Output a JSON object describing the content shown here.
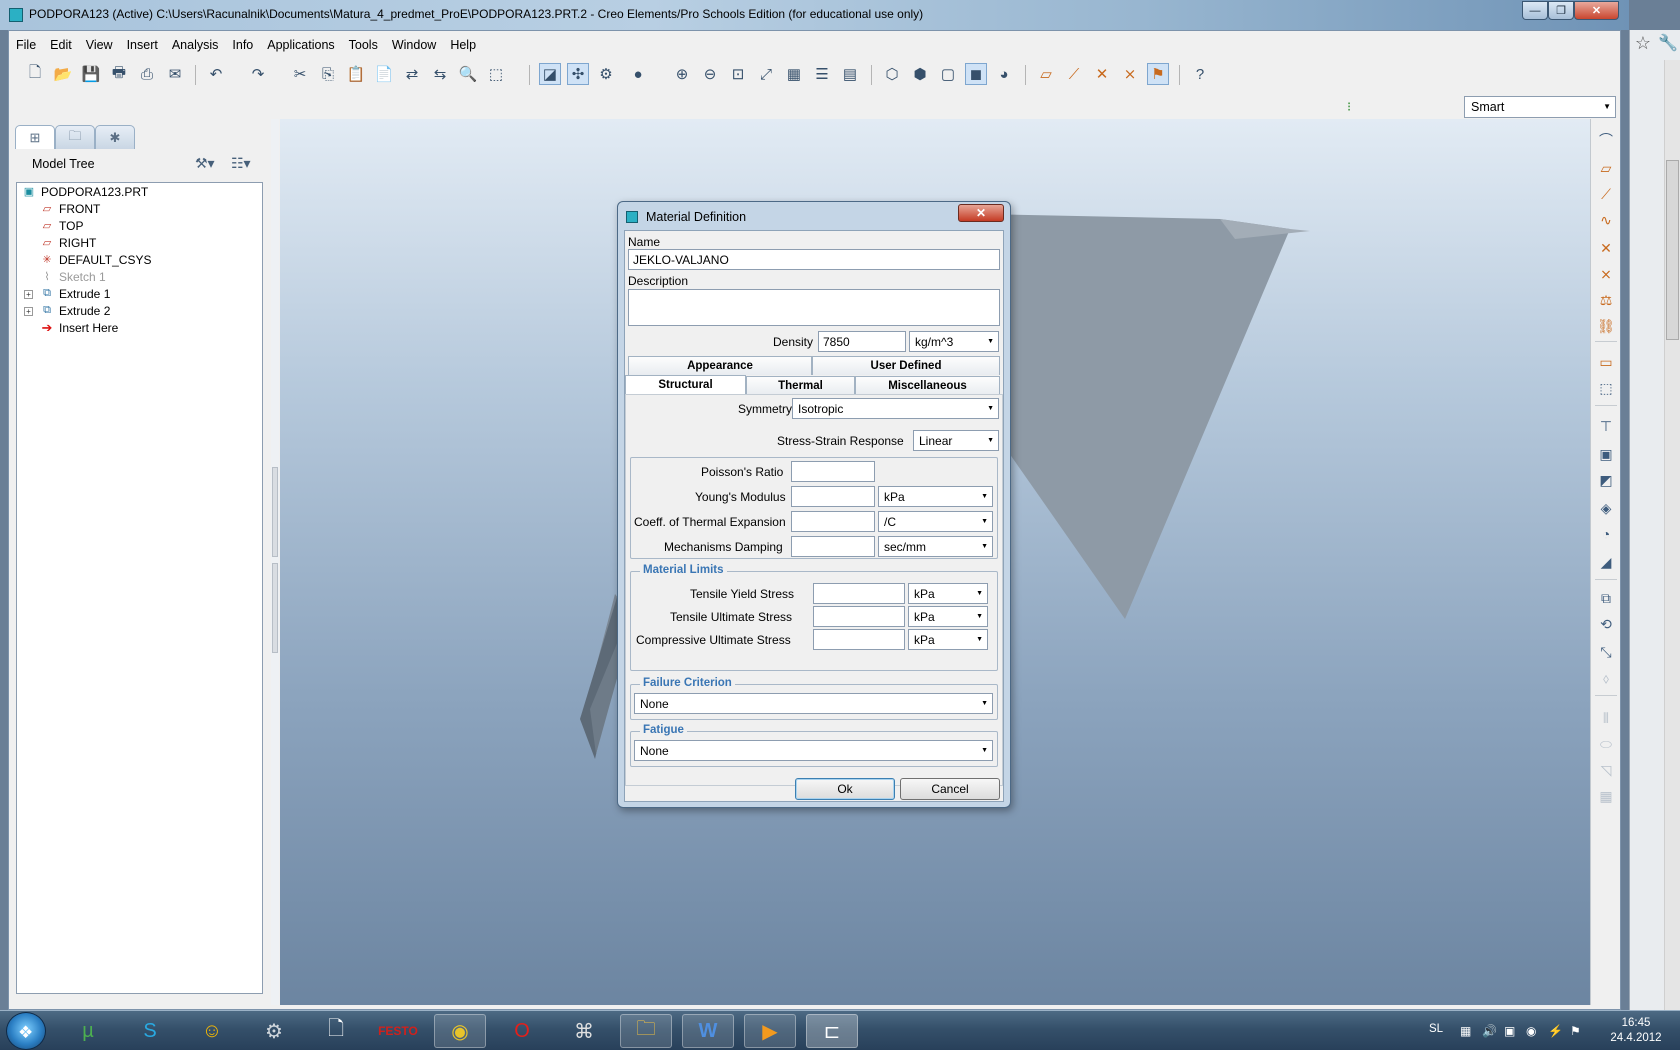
{
  "window": {
    "title": "PODPORA123 (Active) C:\\Users\\Racunalnik\\Documents\\Matura_4_predmet_ProE\\PODPORA123.PRT.2 - Creo Elements/Pro Schools Edition (for educational use only)",
    "minimize": "—",
    "restore": "❐",
    "close": "✕"
  },
  "menu": [
    "File",
    "Edit",
    "View",
    "Insert",
    "Analysis",
    "Info",
    "Applications",
    "Tools",
    "Window",
    "Help"
  ],
  "filter_select": {
    "value": "Smart"
  },
  "model_tree": {
    "title": "Model Tree",
    "items": [
      {
        "label": "PODPORA123.PRT",
        "icon": "part-icon"
      },
      {
        "label": "FRONT",
        "icon": "datum-plane-icon"
      },
      {
        "label": "TOP",
        "icon": "datum-plane-icon"
      },
      {
        "label": "RIGHT",
        "icon": "datum-plane-icon"
      },
      {
        "label": "DEFAULT_CSYS",
        "icon": "csys-icon"
      },
      {
        "label": "Sketch 1",
        "icon": "sketch-icon"
      },
      {
        "label": "Extrude 1",
        "icon": "extrude-icon"
      },
      {
        "label": "Extrude 2",
        "icon": "extrude-icon"
      },
      {
        "label": "Insert Here",
        "icon": "insert-arrow-icon"
      }
    ]
  },
  "dialog": {
    "title": "Material Definition",
    "name_label": "Name",
    "name_value": "JEKLO-VALJANO",
    "description_label": "Description",
    "description_value": "",
    "density_label": "Density",
    "density_value": "7850",
    "density_unit": "kg/m^3",
    "tabs_top": [
      "Appearance",
      "User Defined"
    ],
    "tabs_bottom": [
      "Structural",
      "Thermal",
      "Miscellaneous"
    ],
    "symmetry_label": "Symmetry",
    "symmetry_value": "Isotropic",
    "ss_response_label": "Stress-Strain Response",
    "ss_response_value": "Linear",
    "props": [
      {
        "label": "Poisson's Ratio",
        "value": "",
        "unit": ""
      },
      {
        "label": "Young's Modulus",
        "value": "",
        "unit": "kPa"
      },
      {
        "label": "Coeff. of Thermal Expansion",
        "value": "",
        "unit": "/C"
      },
      {
        "label": "Mechanisms Damping",
        "value": "",
        "unit": "sec/mm"
      }
    ],
    "limits_title": "Material Limits",
    "limits": [
      {
        "label": "Tensile Yield Stress",
        "value": "",
        "unit": "kPa"
      },
      {
        "label": "Tensile Ultimate Stress",
        "value": "",
        "unit": "kPa"
      },
      {
        "label": "Compressive Ultimate Stress",
        "value": "",
        "unit": "kPa"
      }
    ],
    "failure_title": "Failure Criterion",
    "failure_value": "None",
    "fatigue_title": "Fatigue",
    "fatigue_value": "None",
    "ok": "Ok",
    "cancel": "Cancel"
  },
  "taskbar": {
    "lang": "SL",
    "time": "16:45",
    "date": "24.4.2012"
  },
  "colors": {
    "accent_group_title": "#3a76b4",
    "dialog_frame": "#c4d5e6",
    "close_button": "#c43b24"
  }
}
